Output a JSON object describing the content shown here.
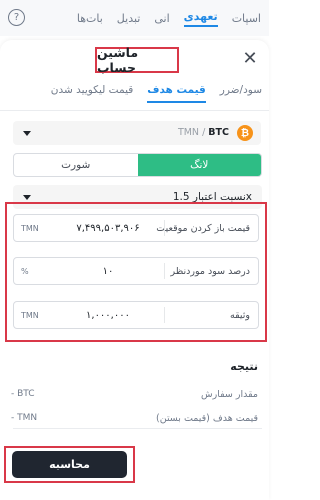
{
  "app_tabs": [
    "اسپات",
    "تعهدی",
    "انی",
    "تبدیل",
    "بات‌ها"
  ],
  "app_tab_active": 1,
  "sheet": {
    "title": "ماشین حساب",
    "close_symbol": "✕"
  },
  "sub_tabs": [
    "سود/ضرر",
    "قیمت هدف",
    "قیمت لیکویید شدن"
  ],
  "sub_tab_active": 1,
  "pair": {
    "base": "BTC",
    "separator": " / ",
    "quote": "TMN",
    "icon_symbol": "₿"
  },
  "side_toggle": {
    "long_label": "لانگ",
    "short_label": "شورت",
    "selected": "long"
  },
  "leverage": {
    "label": "نسبت اعتبار 1.5x"
  },
  "inputs": {
    "entry_price": {
      "label": "قیمت باز کردن موقعیت",
      "value": "۷,۴۹۹,۵۰۳,۹۰۶",
      "unit": "TMN"
    },
    "target_roe": {
      "label": "درصد سود موردنظر",
      "value": "۱۰",
      "unit": "%"
    },
    "margin": {
      "label": "وثیقه",
      "value": "۱,۰۰۰,۰۰۰",
      "unit": "TMN"
    }
  },
  "results": {
    "title": "نتیجه",
    "order_qty": {
      "label": "مقدار سفارش",
      "value": "- BTC"
    },
    "target_price": {
      "label": "قیمت هدف (قیمت بستن)",
      "value": "- TMN"
    }
  },
  "calculate_button": {
    "label": "محاسبه"
  },
  "colors": {
    "accent_blue": "#1e88e5",
    "long_green": "#2ebd85",
    "highlight_red": "#d93848",
    "button_dark": "#202630",
    "btc_orange": "#f7931a"
  },
  "icons": {
    "help": "help-icon",
    "close": "close-icon",
    "coin": "bitcoin-icon",
    "dropdown": "chevron-down-icon"
  }
}
